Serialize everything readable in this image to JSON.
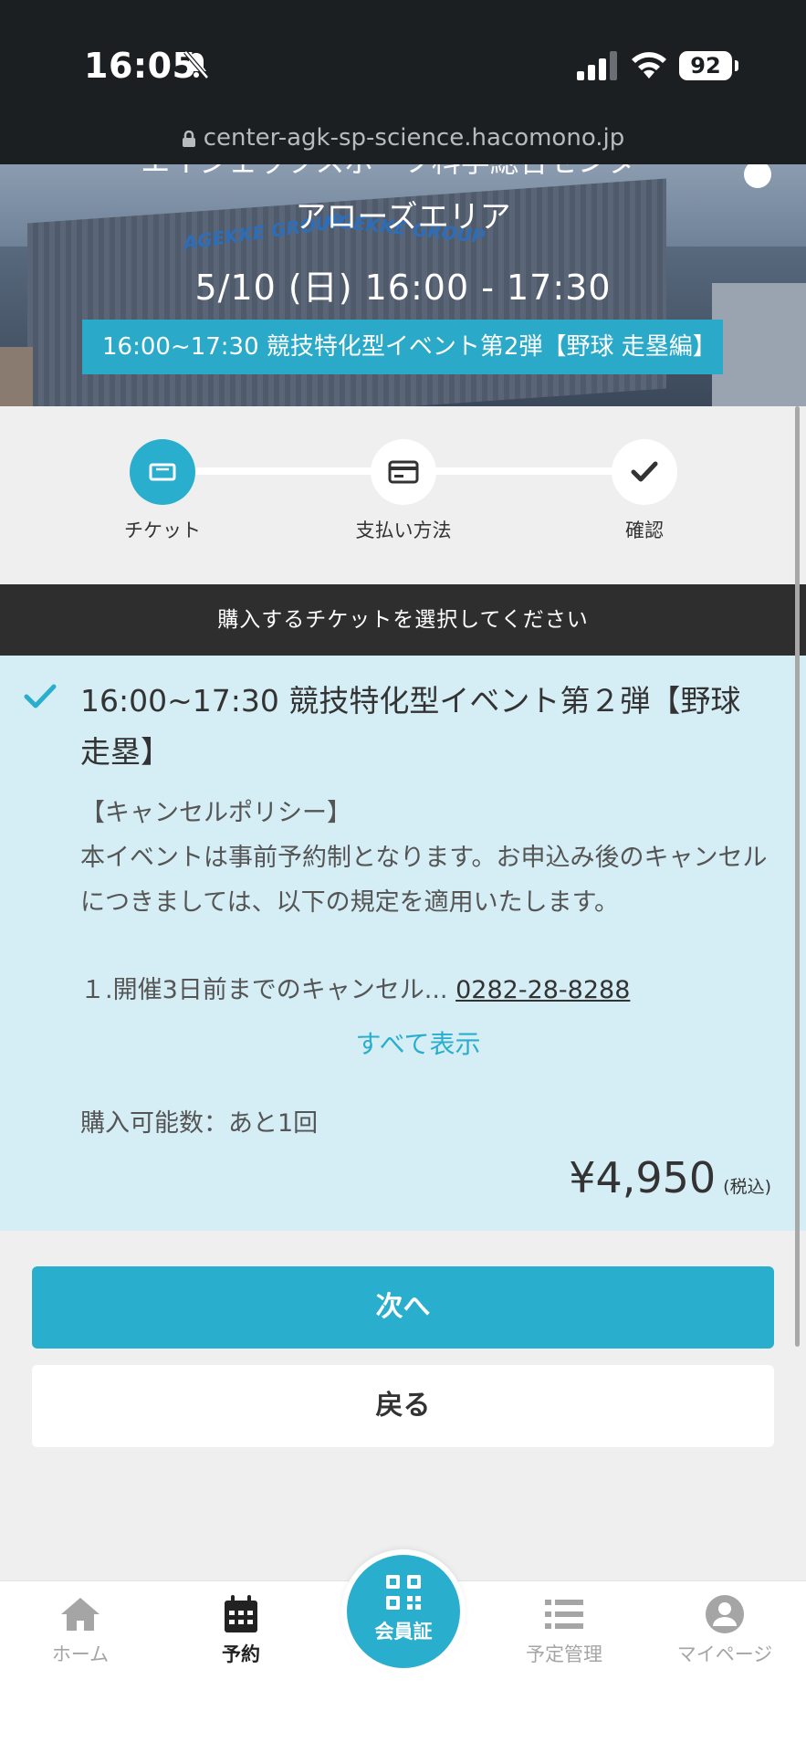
{
  "status_bar": {
    "time": "16:05",
    "battery": "92"
  },
  "browser": {
    "url": "center-agk-sp-science.hacomono.jp"
  },
  "hero": {
    "facility_partial": "エイジェックスポーツ科学総合センター",
    "area": "アローズエリア",
    "date_time": "5/10 (日) 16:00 - 17:30",
    "event_banner": "16:00~17:30 競技特化型イベント第2弾【野球 走塁編】",
    "logo_text": "AGEKKE GROUP"
  },
  "steps": [
    {
      "label": "チケット",
      "icon": "ticket-icon",
      "active": true
    },
    {
      "label": "支払い方法",
      "icon": "card-icon",
      "active": false
    },
    {
      "label": "確認",
      "icon": "check-icon",
      "active": false
    }
  ],
  "section_header": "購入するチケットを選択してください",
  "ticket": {
    "title": "16:00~17:30 競技特化型イベント第２弾【野球 走塁】",
    "policy_heading": "【キャンセルポリシー】",
    "policy_text": "本イベントは事前予約制となります。お申込み後のキャンセルにつきましては、以下の規定を適用いたします。",
    "policy_item": "１.開催3日前までのキャンセル...",
    "phone": "0282-28-8288",
    "show_all": "すべて表示",
    "remaining": "購入可能数：あと1回",
    "price": "¥4,950",
    "tax_note": "(税込)"
  },
  "buttons": {
    "next": "次へ",
    "back": "戻る"
  },
  "bottom_nav": {
    "home": "ホーム",
    "reserve": "予約",
    "member_card": "会員証",
    "schedule": "予定管理",
    "mypage": "マイページ"
  },
  "colors": {
    "accent": "#2aaecd",
    "ticket_bg": "#d5edf4",
    "header_bg": "#2e2e2e"
  }
}
